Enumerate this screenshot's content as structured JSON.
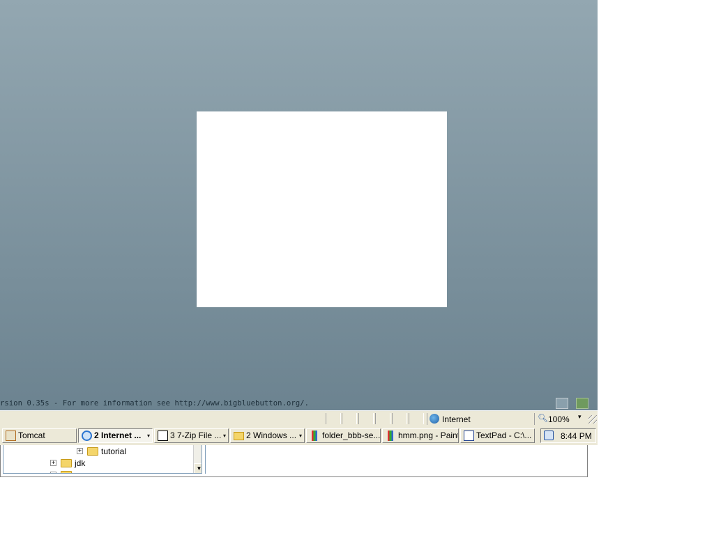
{
  "app": {
    "footer_text": "rsion 0.35s - For more information see http://www.bigbluebutton.org/.",
    "icons": [
      "layout-icon",
      "fullscreen-icon"
    ]
  },
  "statusbar": {
    "zone": "Internet",
    "zoom": "100%",
    "zoom_arrow": "▾"
  },
  "taskbar": {
    "items": [
      {
        "label": "Tomcat",
        "icon": "java-icon"
      },
      {
        "label": "2 Internet ...",
        "icon": "ie-icon",
        "arrow": "▾",
        "active": true
      },
      {
        "label": "3 7-Zip File ...",
        "icon": "7zip-icon",
        "arrow": "▾"
      },
      {
        "label": "2 Windows ...",
        "icon": "folder-icon",
        "arrow": "▾"
      },
      {
        "label": "folder_bbb-se...",
        "icon": "paint-icon"
      },
      {
        "label": "hmm.png - Paint",
        "icon": "paint-icon"
      },
      {
        "label": "TextPad - C:\\...",
        "icon": "textpad-icon"
      }
    ],
    "clock": "8:44 PM"
  },
  "explorer": {
    "tree": [
      {
        "label": "tutorial",
        "expander": "+"
      },
      {
        "label": "jdk",
        "expander": "+"
      }
    ]
  },
  "colors": {
    "app_gradient_top": "#93a7b1",
    "app_gradient_bottom": "#6c8390",
    "chrome": "#ece9d8"
  }
}
